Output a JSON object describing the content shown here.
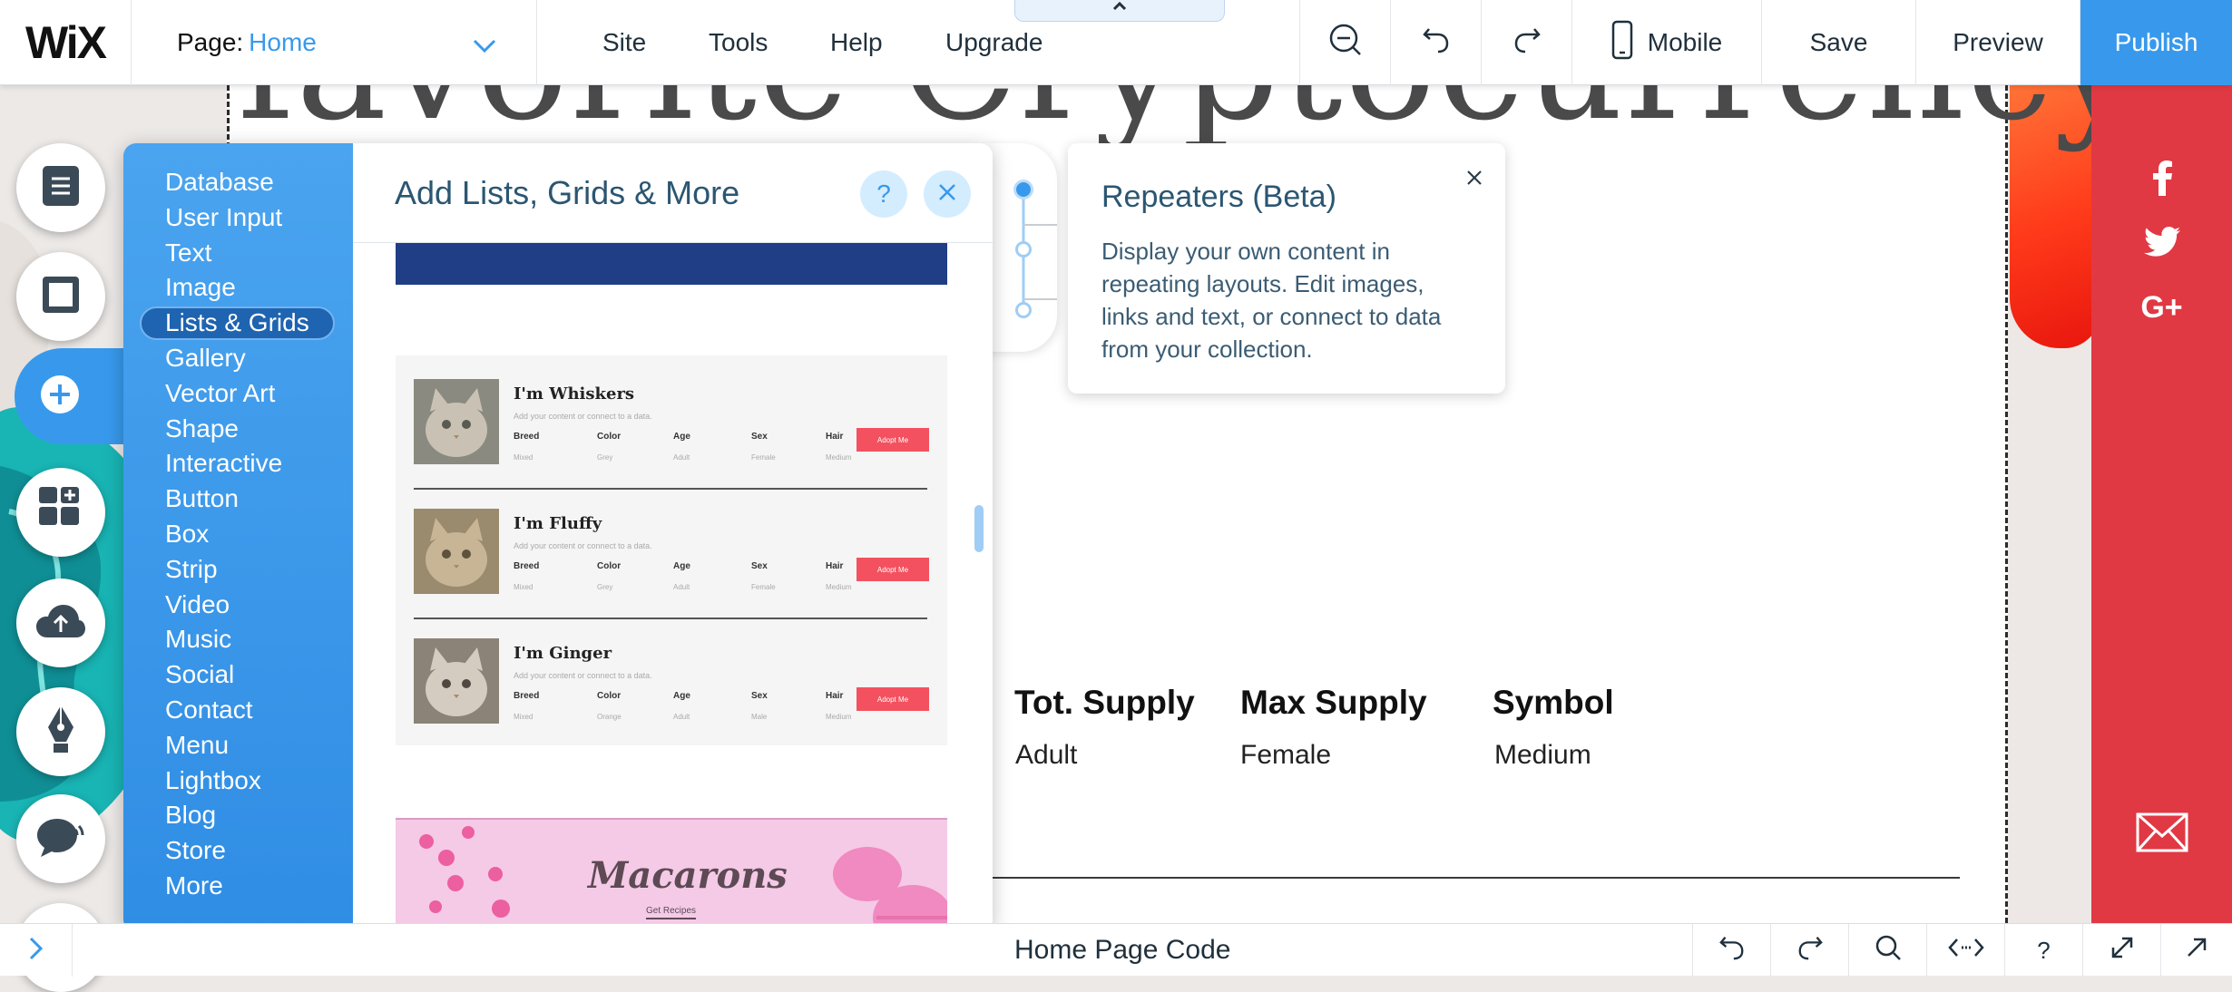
{
  "topbar": {
    "logo": "WiX",
    "page_label": "Page:",
    "page_value": "Home",
    "menu": [
      "Site",
      "Tools",
      "Help",
      "Upgrade"
    ],
    "mobile_label": "Mobile",
    "save_label": "Save",
    "preview_label": "Preview",
    "publish_label": "Publish"
  },
  "hero": {
    "heading": "favorite Cryptocurrency?"
  },
  "stats": {
    "headers": [
      "Tot. Supply",
      "Max Supply",
      "Symbol"
    ],
    "values": [
      "Adult",
      "Female",
      "Medium"
    ]
  },
  "add_panel": {
    "title": "Add Lists, Grids & More",
    "help_label": "?",
    "categories": [
      "Database",
      "User Input",
      "Text",
      "Image",
      "Lists & Grids",
      "Gallery",
      "Vector Art",
      "Shape",
      "Interactive",
      "Button",
      "Box",
      "Strip",
      "Video",
      "Music",
      "Social",
      "Contact",
      "Menu",
      "Lightbox",
      "Blog",
      "Store",
      "More"
    ],
    "active_category": "Lists & Grids",
    "repeater": {
      "items": [
        {
          "name": "I'm Whiskers",
          "fields": [
            "Mixed",
            "Grey",
            "Adult",
            "Female",
            "Medium"
          ]
        },
        {
          "name": "I'm Fluffy",
          "fields": [
            "Mixed",
            "Grey",
            "Adult",
            "Female",
            "Medium"
          ]
        },
        {
          "name": "I'm Ginger",
          "fields": [
            "Mixed",
            "Orange",
            "Adult",
            "Male",
            "Medium"
          ]
        }
      ],
      "subtitle": "Add your content or connect to a data.",
      "field_labels": [
        "Breed",
        "Color",
        "Age",
        "Sex",
        "Hair"
      ],
      "button_label": "Adopt Me"
    },
    "macarons": {
      "title": "Macarons",
      "subtitle": "Get Recipes"
    }
  },
  "tooltip": {
    "title": "Repeaters (Beta)",
    "body": "Display your own content in repeating layouts. Edit images, links and text, or connect to data from your collection."
  },
  "code_panel": {
    "title": "Home Page Code",
    "help_label": "?"
  },
  "colors": {
    "accent": "#3899ec",
    "social_bar": "#e03944",
    "adopt_button": "#f3515f"
  },
  "icons": {
    "rail": [
      "pages-icon",
      "background-icon",
      "add-icon",
      "app-market-icon",
      "upload-icon",
      "blog-pen-icon",
      "chat-icon"
    ],
    "social": [
      "facebook-icon",
      "twitter-icon",
      "google-plus-icon",
      "mail-icon"
    ]
  }
}
